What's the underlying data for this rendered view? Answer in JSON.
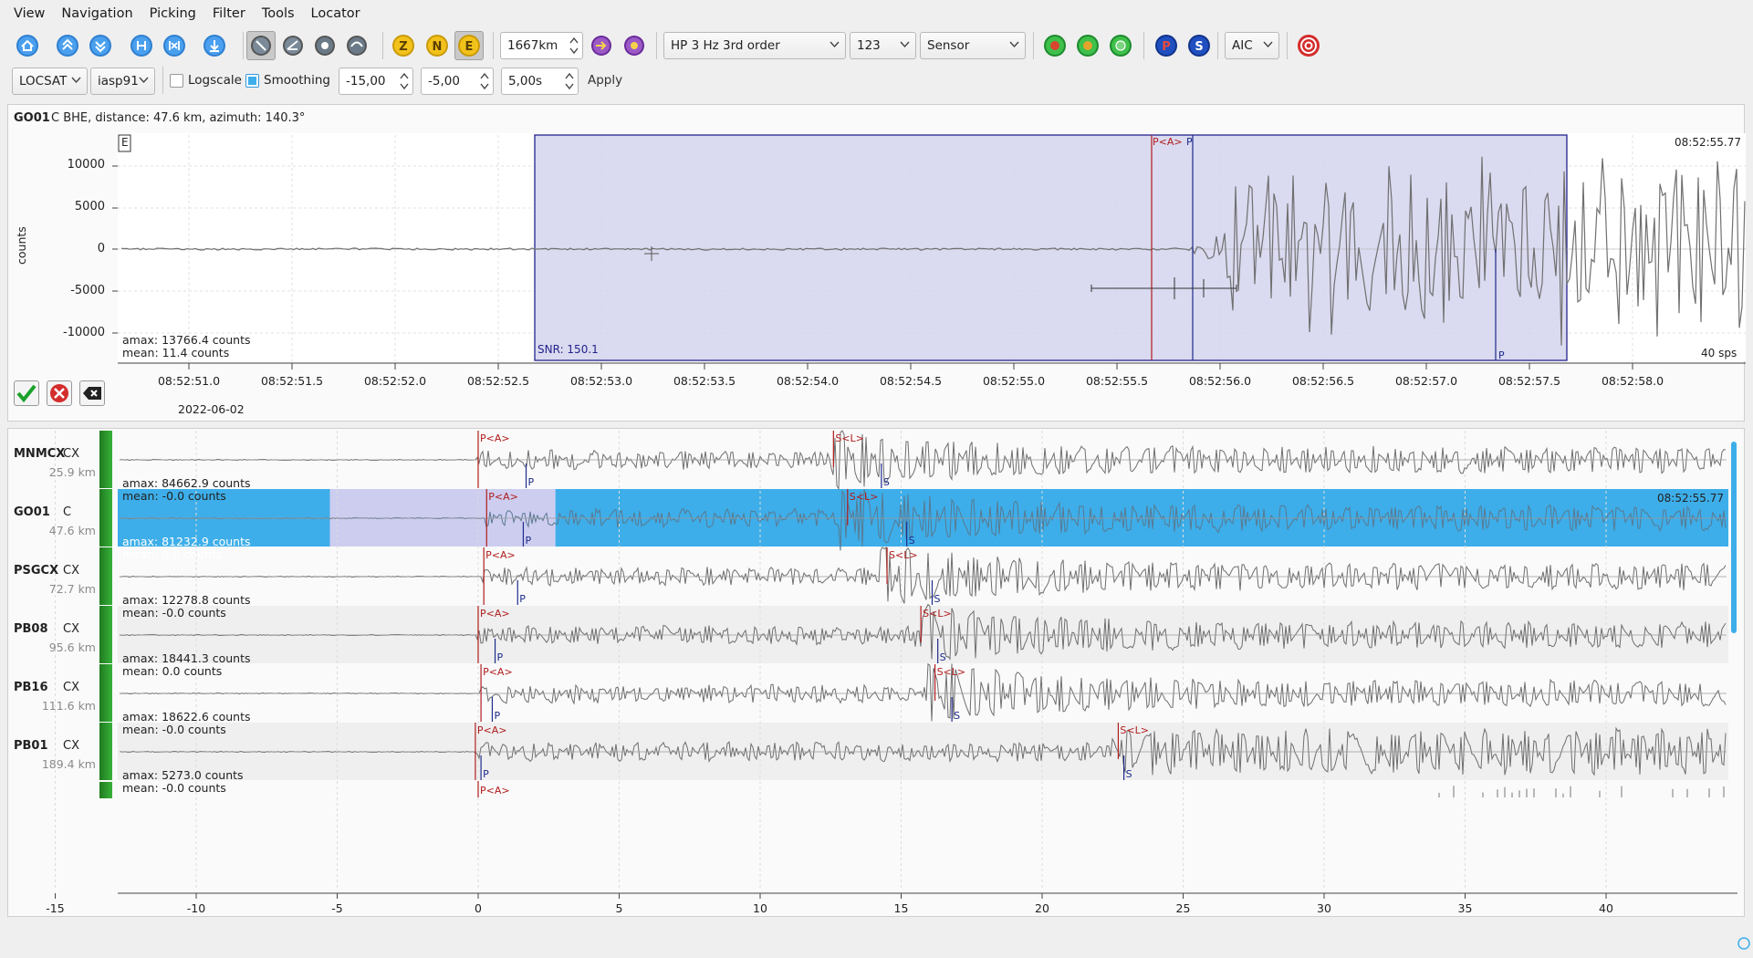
{
  "menu": [
    "View",
    "Navigation",
    "Picking",
    "Filter",
    "Tools",
    "Locator"
  ],
  "toolbar1": {
    "distance_value": "1667km",
    "filter_value": "HP 3 Hz  3rd order",
    "channel_value": "123",
    "component_mode": "Sensor",
    "picker_value": "AIC",
    "comp_buttons": [
      "Z",
      "N",
      "E"
    ],
    "phase_buttons": [
      "P",
      "S"
    ]
  },
  "toolbar2": {
    "locator": "LOCSAT",
    "model": "iasp91",
    "logscale_label": "Logscale",
    "logscale_checked": false,
    "smoothing_label": "Smoothing",
    "smoothing_checked": true,
    "pre_value": "-15,00",
    "post_value": "-5,00",
    "length_value": "5,00s",
    "apply_label": "Apply"
  },
  "zoom_panel": {
    "header_station": "GO01",
    "header_rest": "C  BHE, distance: 47.6 km, azimuth: 140.3°",
    "component_tag": "E",
    "ylabel": "counts",
    "y_ticks": [
      "10000",
      "5000",
      "0",
      "-5000",
      "-10000"
    ],
    "x_ticks": [
      "08:52:51.0",
      "08:52:51.5",
      "08:52:52.0",
      "08:52:52.5",
      "08:52:53.0",
      "08:52:53.5",
      "08:52:54.0",
      "08:52:54.5",
      "08:52:55.0",
      "08:52:55.5",
      "08:52:56.0",
      "08:52:56.5",
      "08:52:57.0",
      "08:52:57.5",
      "08:52:58.0"
    ],
    "date": "2022-06-02",
    "time_label": "08:52:55.77",
    "sps": "40 sps",
    "amax": "amax: 13766.4 counts",
    "mean": "mean: 11.4 counts",
    "snr": "SNR: 150.1",
    "pick_auto": "P<A>",
    "pick_manual": "P",
    "pick_bottom": "P",
    "colors": {
      "selection": "#d6d6ee",
      "selection_border": "#23238c",
      "pick_auto": "#b01c1c",
      "pick_manual": "#1c2a8c"
    }
  },
  "traces": [
    {
      "station": "MNMCX",
      "network": "CX",
      "distance": "25.9 km",
      "amax": "amax: 84662.9 counts",
      "mean": "mean: -0.0 counts",
      "p_label": "P<A>",
      "s_label": "S<L>",
      "p_theo": "P",
      "s_theo": "S",
      "selected": false
    },
    {
      "station": "GO01",
      "network": "C",
      "distance": "47.6 km",
      "amax": "amax: 81232.9 counts",
      "mean": "mean: 0.0 counts",
      "p_label": "P<A>",
      "s_label": "S<L>",
      "p_theo": "P",
      "s_theo": "S",
      "selected": true,
      "time_label": "08:52:55.77"
    },
    {
      "station": "PSGCX",
      "network": "CX",
      "distance": "72.7 km",
      "amax": "amax: 12278.8 counts",
      "mean": "mean: -0.0 counts",
      "p_label": "P<A>",
      "s_label": "S<L>",
      "p_theo": "P",
      "s_theo": "S",
      "selected": false
    },
    {
      "station": "PB08",
      "network": "CX",
      "distance": "95.6 km",
      "amax": "amax: 18441.3 counts",
      "mean": "mean: 0.0 counts",
      "p_label": "P<A>",
      "s_label": "S<L>",
      "p_theo": "P",
      "s_theo": "S",
      "selected": false
    },
    {
      "station": "PB16",
      "network": "CX",
      "distance": "111.6 km",
      "amax": "amax: 18622.6 counts",
      "mean": "mean: -0.0 counts",
      "p_label": "P<A>",
      "s_label": "S<L>",
      "p_theo": "P",
      "s_theo": "S",
      "selected": false
    },
    {
      "station": "PB01",
      "network": "CX",
      "distance": "189.4 km",
      "amax": "amax: 5273.0 counts",
      "mean": "mean: -0.0 counts",
      "p_label": "P<A>",
      "s_label": "S<L>",
      "p_theo": "P",
      "s_theo": "S",
      "selected": false
    }
  ],
  "partial_trace_label": "P<A>",
  "bottom_axis_ticks": [
    "-15",
    "-10",
    "-5",
    "0",
    "5",
    "10",
    "15",
    "20",
    "25",
    "30",
    "35",
    "40"
  ]
}
